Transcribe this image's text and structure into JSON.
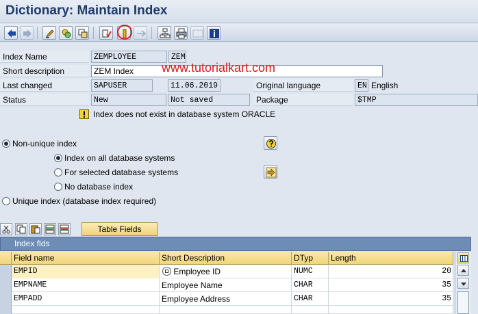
{
  "title": "Dictionary: Maintain Index",
  "toolbar": {
    "buttons": [
      "back-icon",
      "forward-icon",
      "edit-icon",
      "display-change-icon",
      "other-object-icon",
      "check-icon",
      "activate-icon",
      "where-used-icon",
      "hierarchy-icon",
      "print-icon",
      "blank-icon",
      "info-icon"
    ]
  },
  "watermark": "www.tutorialkart.com",
  "form": {
    "index_name_label": "Index Name",
    "index_name_value": "ZEMPLOYEE",
    "index_id_value": "ZEM",
    "short_desc_label": "Short description",
    "short_desc_value": "ZEM Index",
    "last_changed_label": "Last changed",
    "last_changed_user": "SAPUSER",
    "last_changed_date": "11.06.2019",
    "orig_lang_label": "Original language",
    "orig_lang_code": "EN",
    "orig_lang_name": "English",
    "status_label": "Status",
    "status_value": "New",
    "status_saved": "Not saved",
    "package_label": "Package",
    "package_value": "$TMP",
    "warning": "Index does not exist in database system ORACLE"
  },
  "options": {
    "non_unique": "Non-unique index",
    "all_db": "Index on all database systems",
    "selected_db": "For selected database systems",
    "no_db": "No database index",
    "unique": "Unique index (database index required)",
    "selected": [
      "non_unique",
      "all_db"
    ]
  },
  "table": {
    "fields_button": "Table Fields",
    "title": "Index flds",
    "columns": [
      "Field name",
      "Short Description",
      "DTyp",
      "Length"
    ],
    "rows": [
      {
        "field": "EMPID",
        "desc": "Employee ID",
        "dtyp": "NUMC",
        "length": "20"
      },
      {
        "field": "EMPNAME",
        "desc": "Employee Name",
        "dtyp": "CHAR",
        "length": "35"
      },
      {
        "field": "EMPADD",
        "desc": "Employee Address",
        "dtyp": "CHAR",
        "length": "35"
      },
      {
        "field": "",
        "desc": "",
        "dtyp": "",
        "length": ""
      }
    ]
  },
  "colors": {
    "title": "#1f3a6b",
    "table_header": "#f1d57e",
    "table_title": "#6d8cb6",
    "watermark": "#d21c1c"
  }
}
